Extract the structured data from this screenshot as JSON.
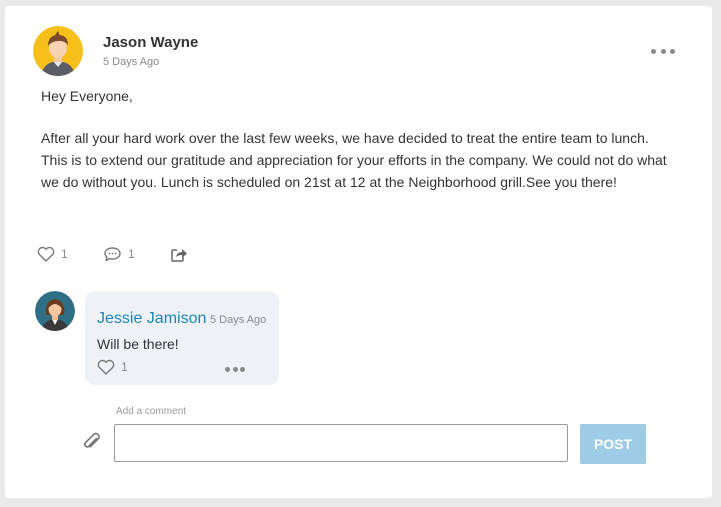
{
  "post": {
    "author": "Jason Wayne",
    "time": "5 Days Ago",
    "greeting": "Hey Everyone,",
    "body": "After all your hard work over the last few weeks, we have decided to treat the entire team to lunch. This is to extend our gratitude and appreciation for your efforts in the company. We could not do what we do without you. Lunch is scheduled on 21st at 12 at the Neighborhood grill.See you there!",
    "likes": "1",
    "comments": "1",
    "avatar_color": "#f6bf1a"
  },
  "comment": {
    "author": "Jessie Jamison",
    "time": "5 Days Ago",
    "text": "Will be there!",
    "likes": "1",
    "avatar_color": "#2e6f86",
    "name_color": "#1a86b8"
  },
  "composer": {
    "label": "Add a comment",
    "value": "",
    "button": "POST",
    "button_color": "#9ecbe6"
  },
  "icons": [
    "avatar",
    "more-options-icon",
    "heart-icon",
    "comment-icon",
    "share-icon",
    "paperclip-icon"
  ]
}
